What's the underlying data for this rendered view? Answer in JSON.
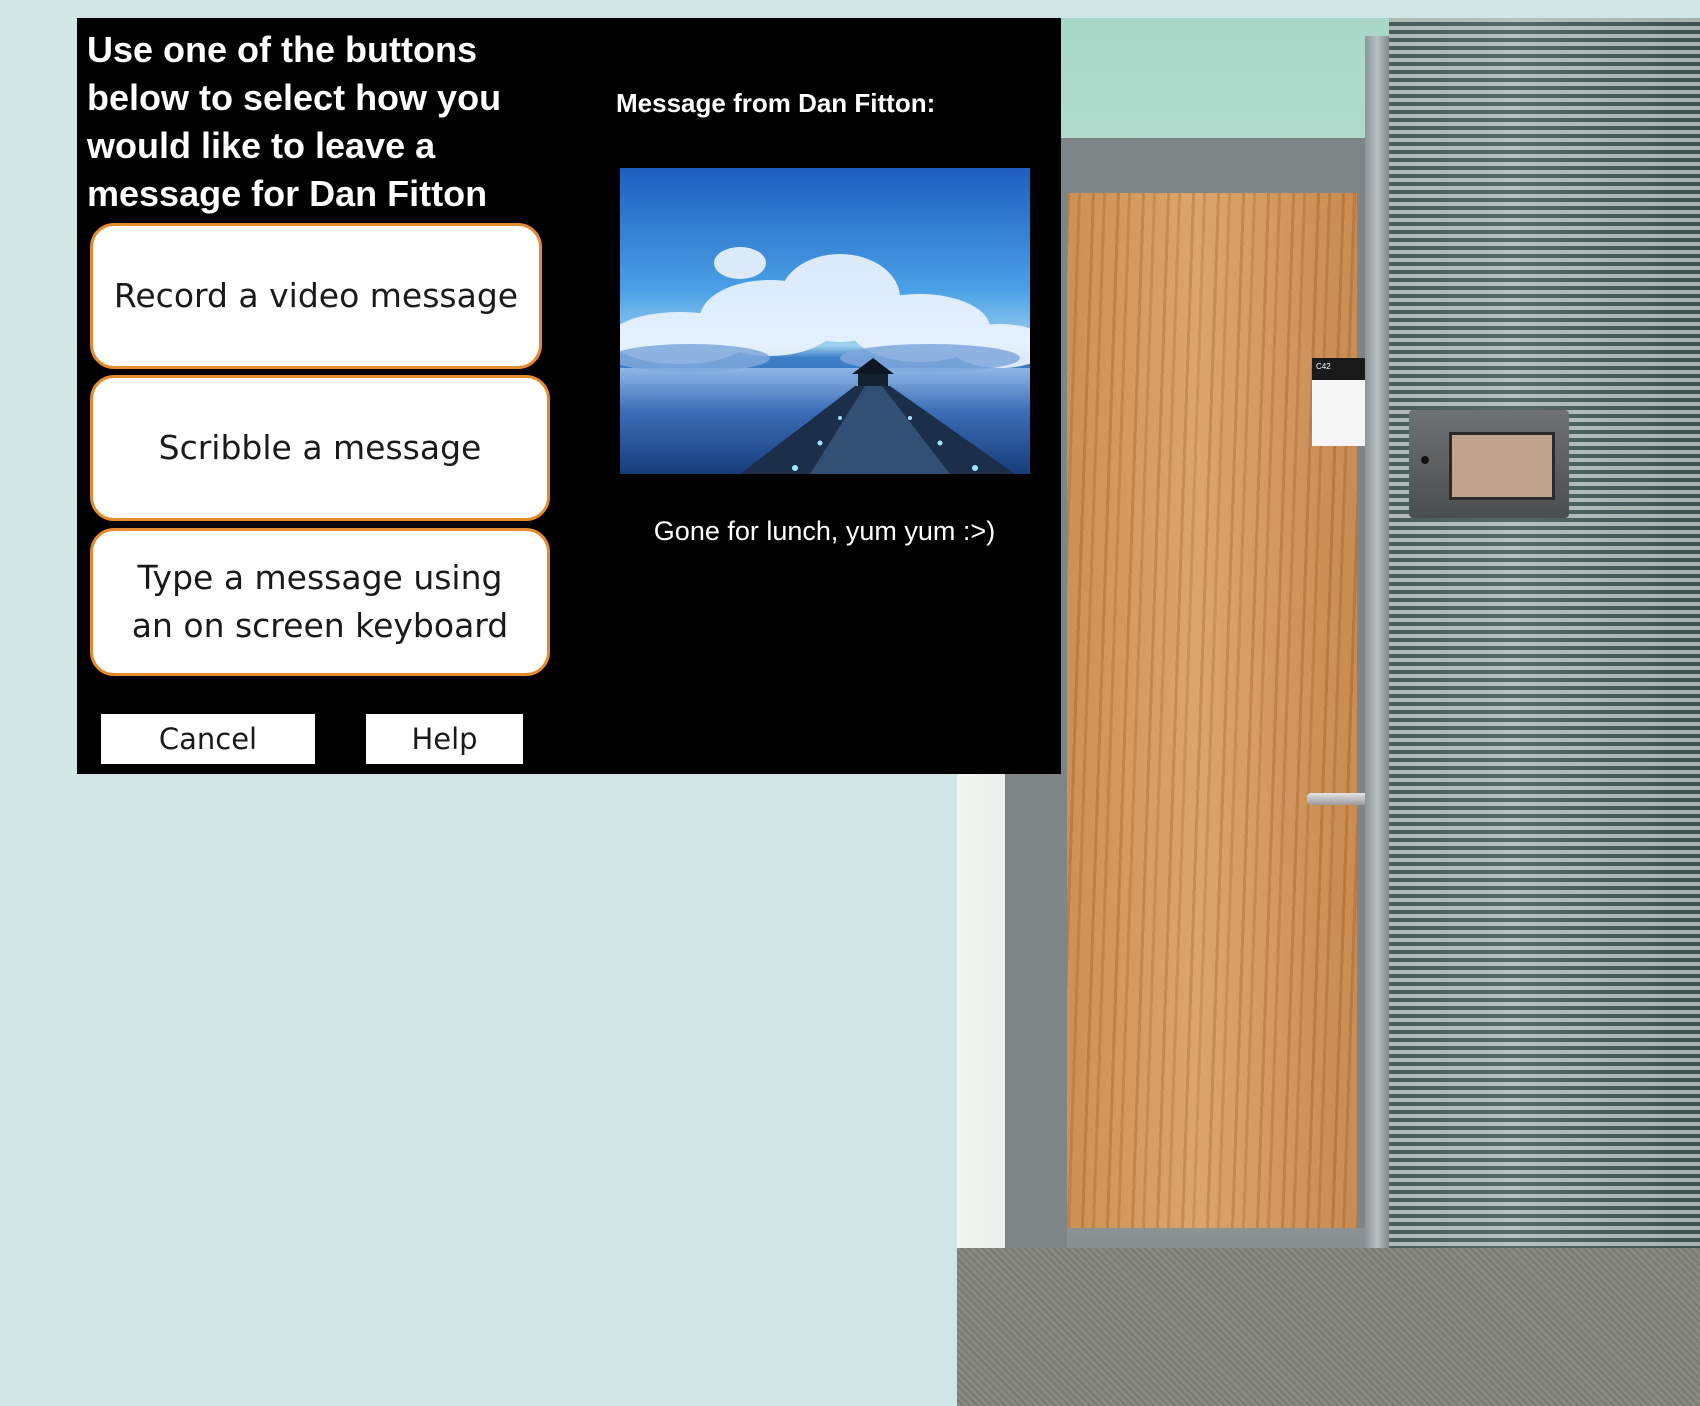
{
  "kiosk": {
    "instructions": "Use one of the buttons below to select how you would like to leave a message for Dan Fitton",
    "options": {
      "video": "Record a video message",
      "scribble": "Scribble a message",
      "type": "Type a message using an on screen keyboard"
    },
    "cancel_label": "Cancel",
    "help_label": "Help",
    "message_heading": "Message from Dan Fitton:",
    "message_text": "Gone for lunch, yum yum :>)"
  },
  "photo": {
    "nameplate_text": "C42"
  },
  "colors": {
    "background": "#d0e6e4",
    "kiosk_background": "#000000",
    "button_border": "#e58a2e"
  }
}
